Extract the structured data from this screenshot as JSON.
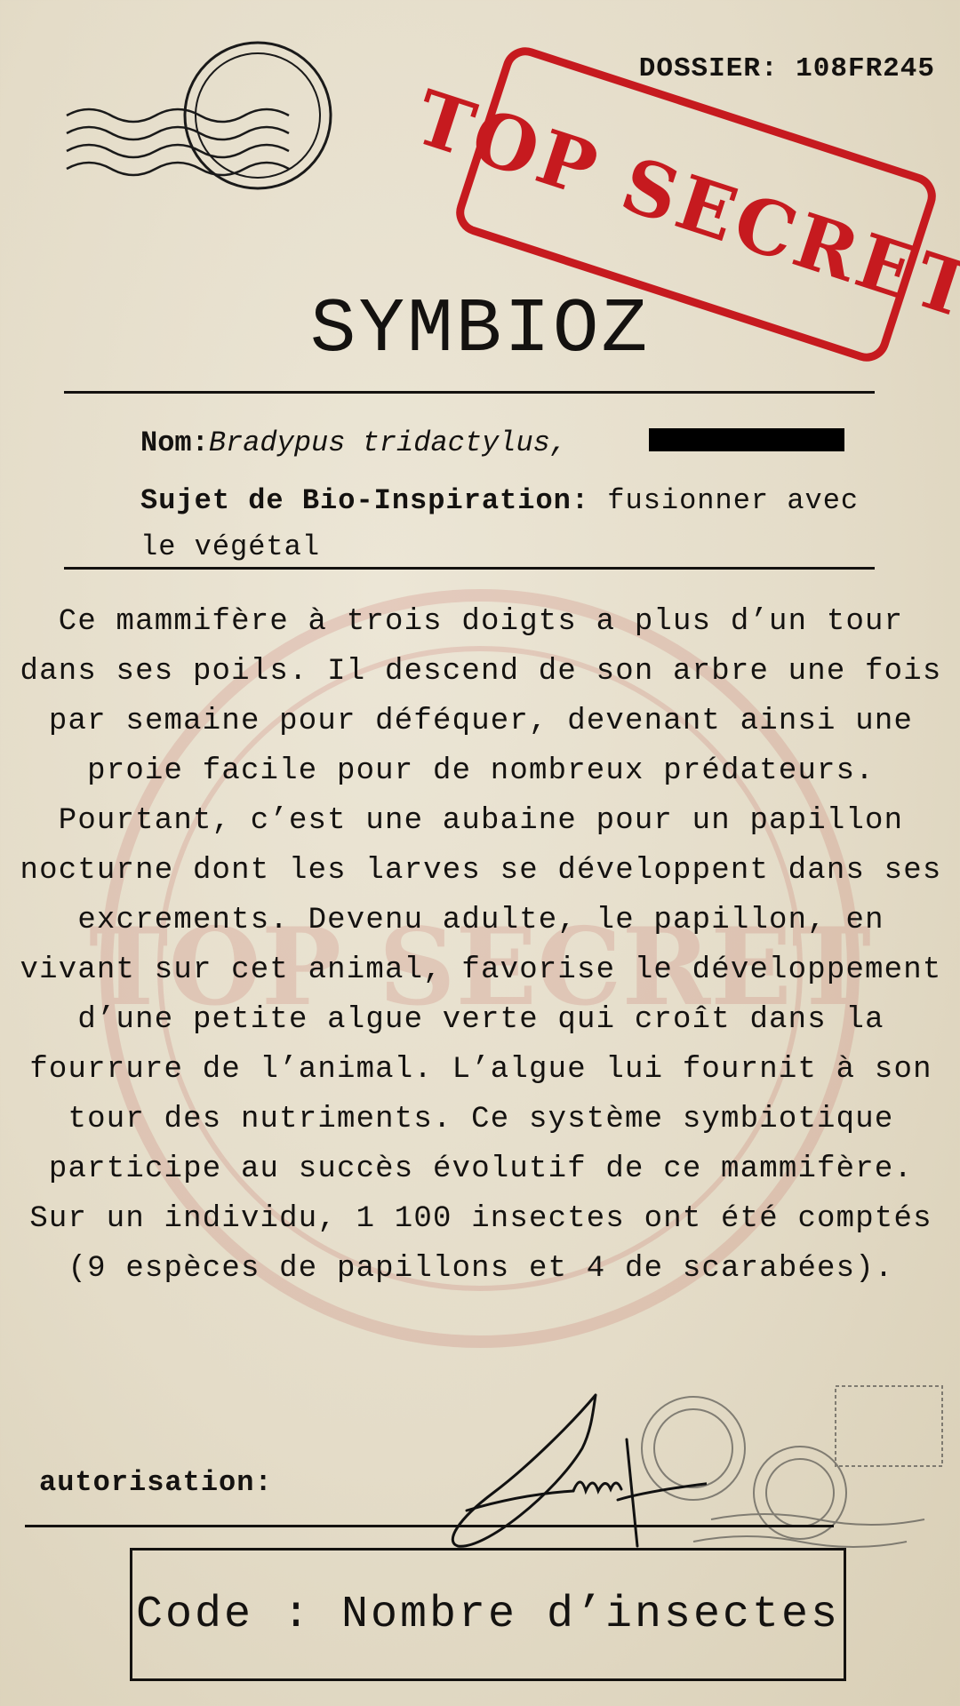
{
  "header": {
    "dossier": "DOSSIER: 108FR245"
  },
  "stamp": {
    "text": "TOP SECRET",
    "color": "#c61a1f"
  },
  "title": "SYMBIOZ",
  "info": {
    "name_label": "Nom:",
    "name_value": "Bradypus tridactylus,",
    "subject_label": "Sujet de Bio-Inspiration:",
    "subject_value": " fusionner avec le végétal"
  },
  "body_text": "Ce mammifère à trois doigts a plus d’un tour dans ses poils. Il descend de son arbre une fois par semaine pour déféquer, devenant ainsi une proie facile pour de nombreux prédateurs. Pourtant, c’est une aubaine pour un papillon nocturne dont les larves se développent dans ses excrements. Devenu adulte, le papillon, en vivant sur cet animal, favorise le développement d’une petite algue verte qui croît dans la fourrure de l’animal. L’algue lui fournit à son tour des nutriments. Ce système symbiotique participe au succès évolutif de ce mammifère. Sur un individu, 1 100 insectes ont été comptés (9 espèces de papillons et 4 de scarabées).",
  "authorization_label": "autorisation:",
  "code_label": "Code : Nombre d’insectes",
  "background_seal_text": "TOP SECRET"
}
